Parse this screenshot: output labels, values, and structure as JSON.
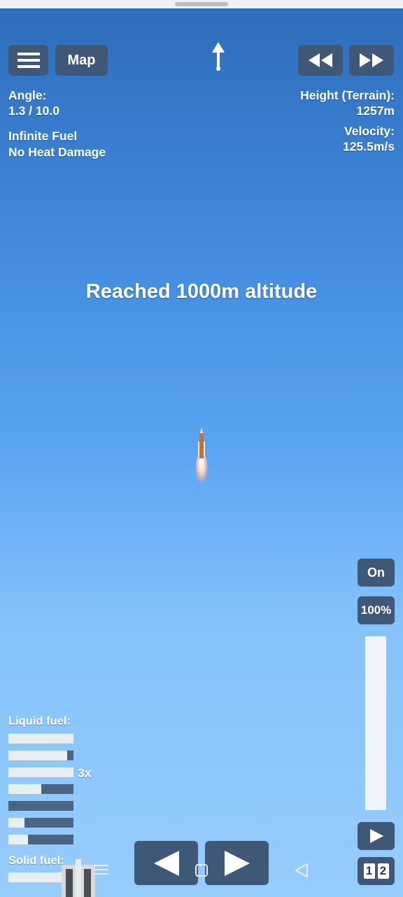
{
  "hud": {
    "map_label": "Map",
    "angle_label": "Angle:",
    "angle_value": "1.3 / 10.0",
    "cheat_1": "Infinite Fuel",
    "cheat_2": "No Heat Damage",
    "height_label": "Height (Terrain):",
    "height_value": "1257m",
    "velocity_label": "Velocity:",
    "velocity_value": "125.5m/s"
  },
  "message": "Reached 1000m altitude",
  "controls": {
    "engine_toggle": "On",
    "throttle_percent": "100%",
    "throttle_level": 1.0,
    "stage_label_1": "1",
    "stage_label_2": "2"
  },
  "fuel": {
    "liquid_label": "Liquid fuel:",
    "multiplier": "3x",
    "solid_label": "Solid fuel:",
    "liquid_levels": [
      1.0,
      0.9,
      1.0,
      0.5,
      0.0,
      0.25,
      0.3
    ],
    "solid_levels": [
      1.0
    ]
  },
  "colors": {
    "sky_top": "#2d6cba",
    "sky_bottom": "#96ccfb",
    "button": "#3f5877",
    "fuel_bar_empty": "#4a6584",
    "fuel_bar_full": "#e9eef3"
  }
}
